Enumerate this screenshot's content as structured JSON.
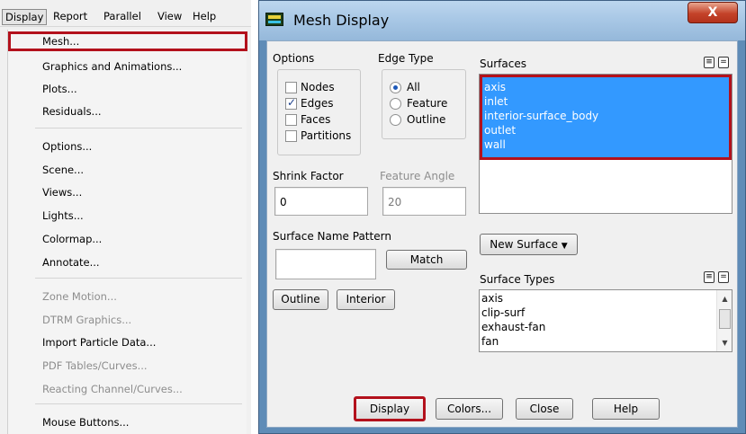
{
  "menubar": {
    "items": [
      "Display",
      "Report",
      "Parallel",
      "View",
      "Help"
    ]
  },
  "display_menu": {
    "items": [
      {
        "label": "Mesh...",
        "enabled": true,
        "highlighted": true
      },
      {
        "label": "Graphics and Animations...",
        "enabled": true
      },
      {
        "label": "Plots...",
        "enabled": true
      },
      {
        "label": "Residuals...",
        "enabled": true
      },
      {
        "label": "Options...",
        "enabled": true
      },
      {
        "label": "Scene...",
        "enabled": true
      },
      {
        "label": "Views...",
        "enabled": true
      },
      {
        "label": "Lights...",
        "enabled": true
      },
      {
        "label": "Colormap...",
        "enabled": true
      },
      {
        "label": "Annotate...",
        "enabled": true
      },
      {
        "label": "Zone Motion...",
        "enabled": false
      },
      {
        "label": "DTRM Graphics...",
        "enabled": false
      },
      {
        "label": "Import Particle Data...",
        "enabled": true
      },
      {
        "label": "PDF Tables/Curves...",
        "enabled": false
      },
      {
        "label": "Reacting Channel/Curves...",
        "enabled": false
      },
      {
        "label": "Mouse Buttons...",
        "enabled": true
      }
    ]
  },
  "dialog": {
    "title": "Mesh Display",
    "close_glyph": "X",
    "options": {
      "heading": "Options",
      "items": [
        {
          "label": "Nodes",
          "checked": false
        },
        {
          "label": "Edges",
          "checked": true
        },
        {
          "label": "Faces",
          "checked": false
        },
        {
          "label": "Partitions",
          "checked": false
        }
      ]
    },
    "edge_type": {
      "heading": "Edge Type",
      "items": [
        {
          "label": "All",
          "selected": true
        },
        {
          "label": "Feature",
          "selected": false
        },
        {
          "label": "Outline",
          "selected": false
        }
      ]
    },
    "shrink_factor": {
      "label": "Shrink Factor",
      "value": "0"
    },
    "feature_angle": {
      "label": "Feature Angle",
      "value": "20"
    },
    "surface_name_pattern": {
      "label": "Surface Name Pattern",
      "value": "",
      "match_button": "Match"
    },
    "outline_button": "Outline",
    "interior_button": "Interior",
    "surfaces": {
      "heading": "Surfaces",
      "items": [
        "axis",
        "inlet",
        "interior-surface_body",
        "outlet",
        "wall"
      ],
      "selected": [
        "axis",
        "inlet",
        "interior-surface_body",
        "outlet",
        "wall"
      ]
    },
    "new_surface_button": "New Surface",
    "surface_types": {
      "heading": "Surface Types",
      "items": [
        "axis",
        "clip-surf",
        "exhaust-fan",
        "fan"
      ]
    },
    "buttons": {
      "display": "Display",
      "colors": "Colors...",
      "close": "Close",
      "help": "Help"
    },
    "colors": {
      "highlight_border": "#b3111c",
      "selection": "#3399ff"
    }
  }
}
